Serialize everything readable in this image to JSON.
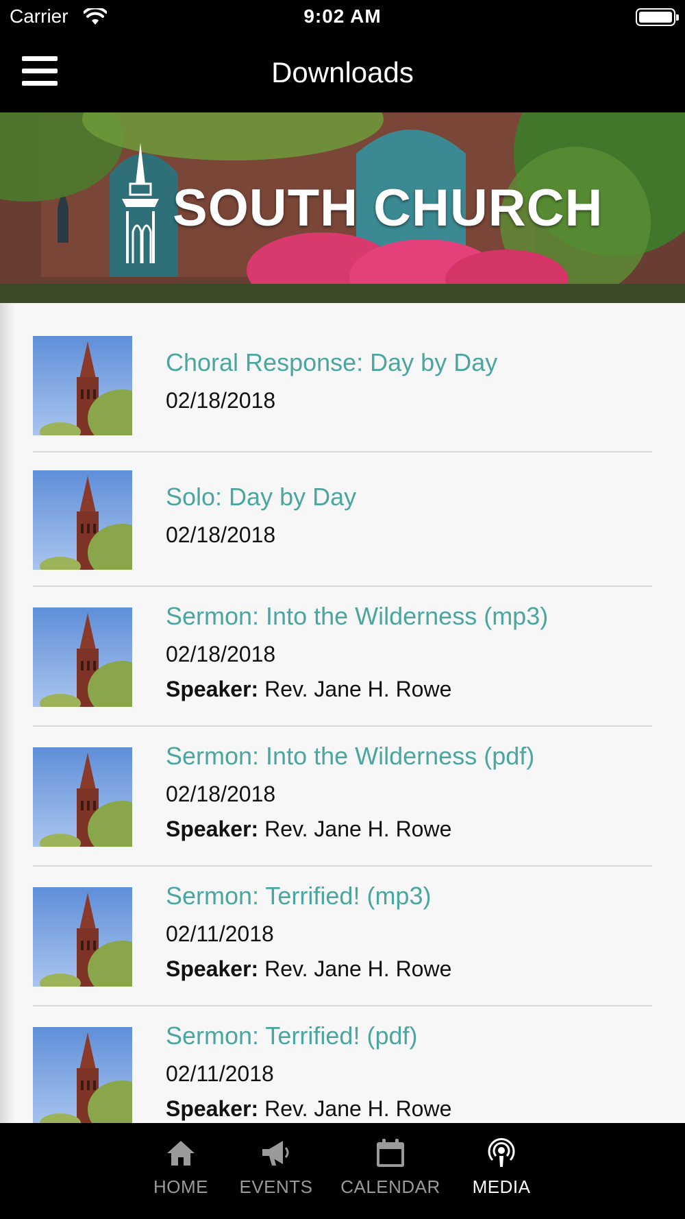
{
  "status_bar": {
    "carrier": "Carrier",
    "time": "9:02 AM"
  },
  "nav": {
    "title": "Downloads"
  },
  "banner": {
    "title": "SOUTH CHURCH"
  },
  "speaker_label": "Speaker:",
  "items": [
    {
      "title": "Choral Response: Day by Day",
      "date": "02/18/2018",
      "speaker": ""
    },
    {
      "title": "Solo: Day by Day",
      "date": "02/18/2018",
      "speaker": ""
    },
    {
      "title": "Sermon: Into the Wilderness (mp3)",
      "date": "02/18/2018",
      "speaker": "Rev. Jane H. Rowe"
    },
    {
      "title": "Sermon: Into the Wilderness (pdf)",
      "date": "02/18/2018",
      "speaker": "Rev. Jane H. Rowe"
    },
    {
      "title": "Sermon: Terrified! (mp3)",
      "date": "02/11/2018",
      "speaker": "Rev. Jane H. Rowe"
    },
    {
      "title": "Sermon: Terrified! (pdf)",
      "date": "02/11/2018",
      "speaker": "Rev. Jane H. Rowe"
    }
  ],
  "tabs": [
    {
      "label": "HOME",
      "icon": "home-icon",
      "active": false
    },
    {
      "label": "EVENTS",
      "icon": "megaphone-icon",
      "active": false
    },
    {
      "label": "CALENDAR",
      "icon": "calendar-icon",
      "active": false
    },
    {
      "label": "MEDIA",
      "icon": "podcast-icon",
      "active": true
    }
  ],
  "colors": {
    "accent": "#4aa69e",
    "bar_background": "#000000",
    "list_background": "#f7f7f7",
    "tab_inactive": "#9a9a9a"
  }
}
